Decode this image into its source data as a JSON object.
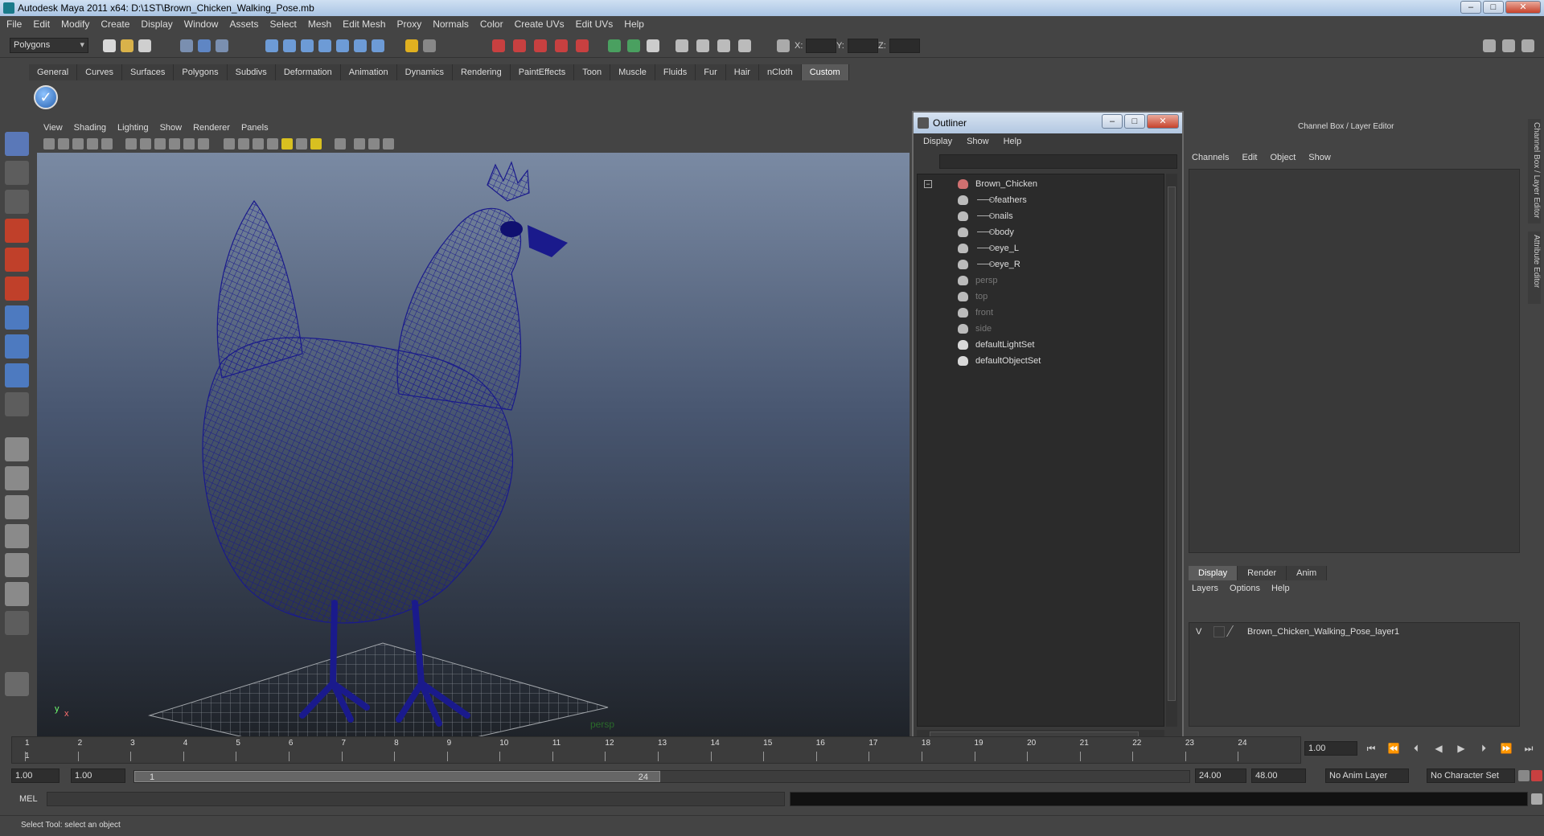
{
  "window": {
    "title": "Autodesk Maya 2011 x64: D:\\1ST\\Brown_Chicken_Walking_Pose.mb",
    "min": "–",
    "max": "□",
    "close": "✕"
  },
  "menubar": [
    "File",
    "Edit",
    "Modify",
    "Create",
    "Display",
    "Window",
    "Assets",
    "Select",
    "Mesh",
    "Edit Mesh",
    "Proxy",
    "Normals",
    "Color",
    "Create UVs",
    "Edit UVs",
    "Help"
  ],
  "toolbar": {
    "mode": "Polygons",
    "x_label": "X:",
    "y_label": "Y:",
    "z_label": "Z:"
  },
  "shelf_tabs": [
    "General",
    "Curves",
    "Surfaces",
    "Polygons",
    "Subdivs",
    "Deformation",
    "Animation",
    "Dynamics",
    "Rendering",
    "PaintEffects",
    "Toon",
    "Muscle",
    "Fluids",
    "Fur",
    "Hair",
    "nCloth",
    "Custom"
  ],
  "shelf_active": "Custom",
  "viewport": {
    "menu": [
      "View",
      "Shading",
      "Lighting",
      "Show",
      "Renderer",
      "Panels"
    ],
    "axis_y": "y",
    "axis_x": "x",
    "camera": "persp",
    "wire_color": "#1a1a8c"
  },
  "outliner": {
    "title": "Outliner",
    "menu": [
      "Display",
      "Show",
      "Help"
    ],
    "expander": "−",
    "items": [
      {
        "label": "Brown_Chicken",
        "kind": "root"
      },
      {
        "label": "feathers",
        "kind": "child"
      },
      {
        "label": "nails",
        "kind": "child"
      },
      {
        "label": "body",
        "kind": "child"
      },
      {
        "label": "eye_L",
        "kind": "child"
      },
      {
        "label": "eye_R",
        "kind": "child"
      },
      {
        "label": "persp",
        "kind": "camera"
      },
      {
        "label": "top",
        "kind": "camera"
      },
      {
        "label": "front",
        "kind": "camera"
      },
      {
        "label": "side",
        "kind": "camera"
      },
      {
        "label": "defaultLightSet",
        "kind": "set"
      },
      {
        "label": "defaultObjectSet",
        "kind": "set"
      }
    ]
  },
  "channelbox": {
    "title": "Channel Box / Layer Editor",
    "menu": [
      "Channels",
      "Edit",
      "Object",
      "Show"
    ],
    "tabs": [
      "Display",
      "Render",
      "Anim"
    ],
    "active_tab": "Display",
    "layer_menu": [
      "Layers",
      "Options",
      "Help"
    ],
    "layer": {
      "visible": "V",
      "name": "Brown_Chicken_Walking_Pose_layer1"
    }
  },
  "side_tabs": [
    "Channel Box / Layer Editor",
    "Attribute Editor"
  ],
  "timeline": {
    "ticks": [
      "1",
      "2",
      "3",
      "4",
      "5",
      "6",
      "7",
      "8",
      "9",
      "10",
      "11",
      "12",
      "13",
      "14",
      "15",
      "16",
      "17",
      "18",
      "19",
      "20",
      "21",
      "22",
      "23",
      "24"
    ],
    "current_marker": "1",
    "current_frame": "1.00"
  },
  "range": {
    "start": "1.00",
    "start2": "1.00",
    "slider_start": "1",
    "slider_end": "24",
    "end": "24.00",
    "end2": "48.00",
    "anim_layer": "No Anim Layer",
    "char_set": "No Character Set"
  },
  "command": {
    "label": "MEL"
  },
  "status": {
    "text": "Select Tool: select an object"
  }
}
